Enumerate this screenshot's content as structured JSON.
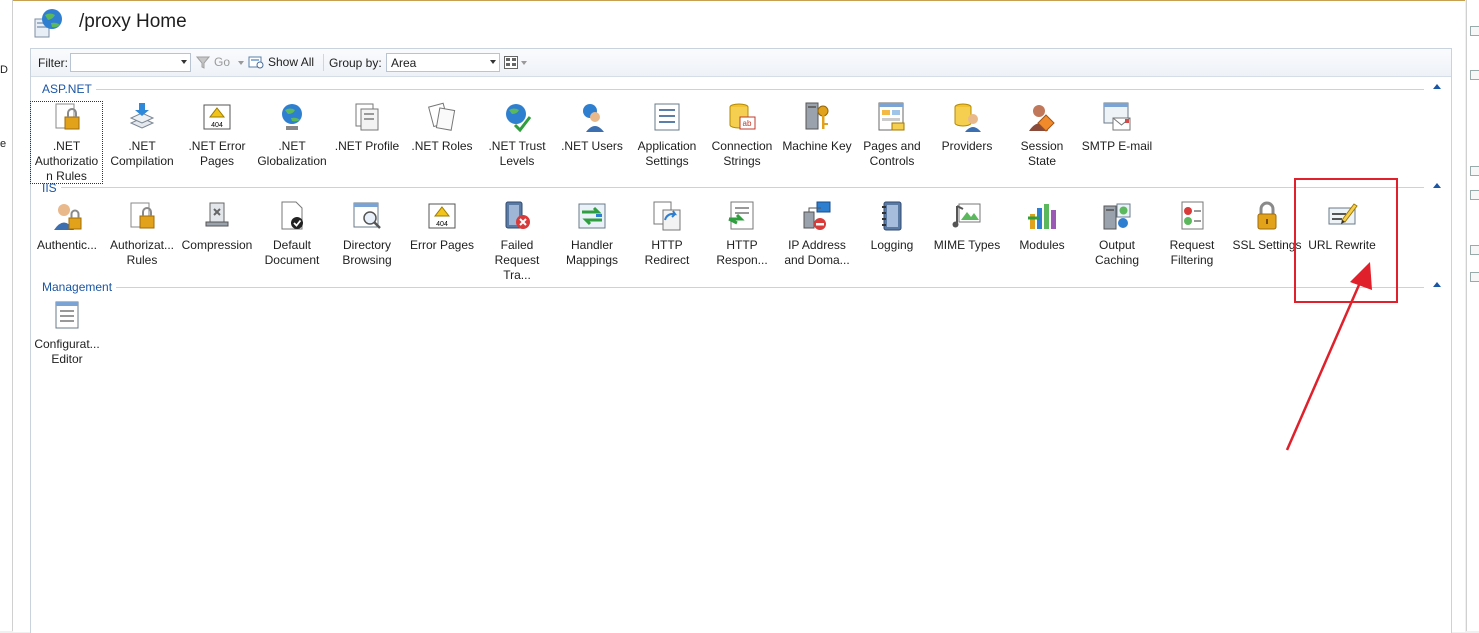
{
  "window": {
    "title": "/proxy Home"
  },
  "left_pane": {
    "fragments": [
      "D",
      "e"
    ]
  },
  "toolbar": {
    "filter_label": "Filter:",
    "filter_value": "",
    "go_label": "Go",
    "show_all_label": "Show All",
    "group_by_label": "Group by:",
    "group_by_value": "Area"
  },
  "sections": {
    "aspnet": {
      "title": "ASP.NET"
    },
    "iis": {
      "title": "IIS"
    },
    "management": {
      "title": "Management"
    }
  },
  "features": {
    "net_authorization": ".NET Authorizatio n Rules",
    "net_compilation": ".NET Compilation",
    "net_error_pages": ".NET Error Pages",
    "net_globalization": ".NET Globalization",
    "net_profile": ".NET Profile",
    "net_roles": ".NET Roles",
    "net_trust_levels": ".NET Trust Levels",
    "net_users": ".NET Users",
    "application_settings": "Application Settings",
    "connection_strings": "Connection Strings",
    "machine_key": "Machine Key",
    "pages_controls": "Pages and Controls",
    "providers": "Providers",
    "session_state": "Session State",
    "smtp_email": "SMTP E-mail",
    "authentication": "Authentic...",
    "authorization_rules": "Authorizat... Rules",
    "compression": "Compression",
    "default_document": "Default Document",
    "directory_browsing": "Directory Browsing",
    "error_pages": "Error Pages",
    "failed_request": "Failed Request Tra...",
    "handler_mappings": "Handler Mappings",
    "http_redirect": "HTTP Redirect",
    "http_response": "HTTP Respon...",
    "ip_domain": "IP Address and Doma...",
    "logging": "Logging",
    "mime_types": "MIME Types",
    "modules": "Modules",
    "output_caching": "Output Caching",
    "request_filtering": "Request Filtering",
    "ssl_settings": "SSL Settings",
    "url_rewrite": "URL Rewrite",
    "configuration_editor": "Configurat... Editor"
  },
  "annotation": {
    "color": "#e0202a"
  },
  "colors": {
    "section_title": "#1a56a6",
    "accent_border": "#c8a052"
  }
}
